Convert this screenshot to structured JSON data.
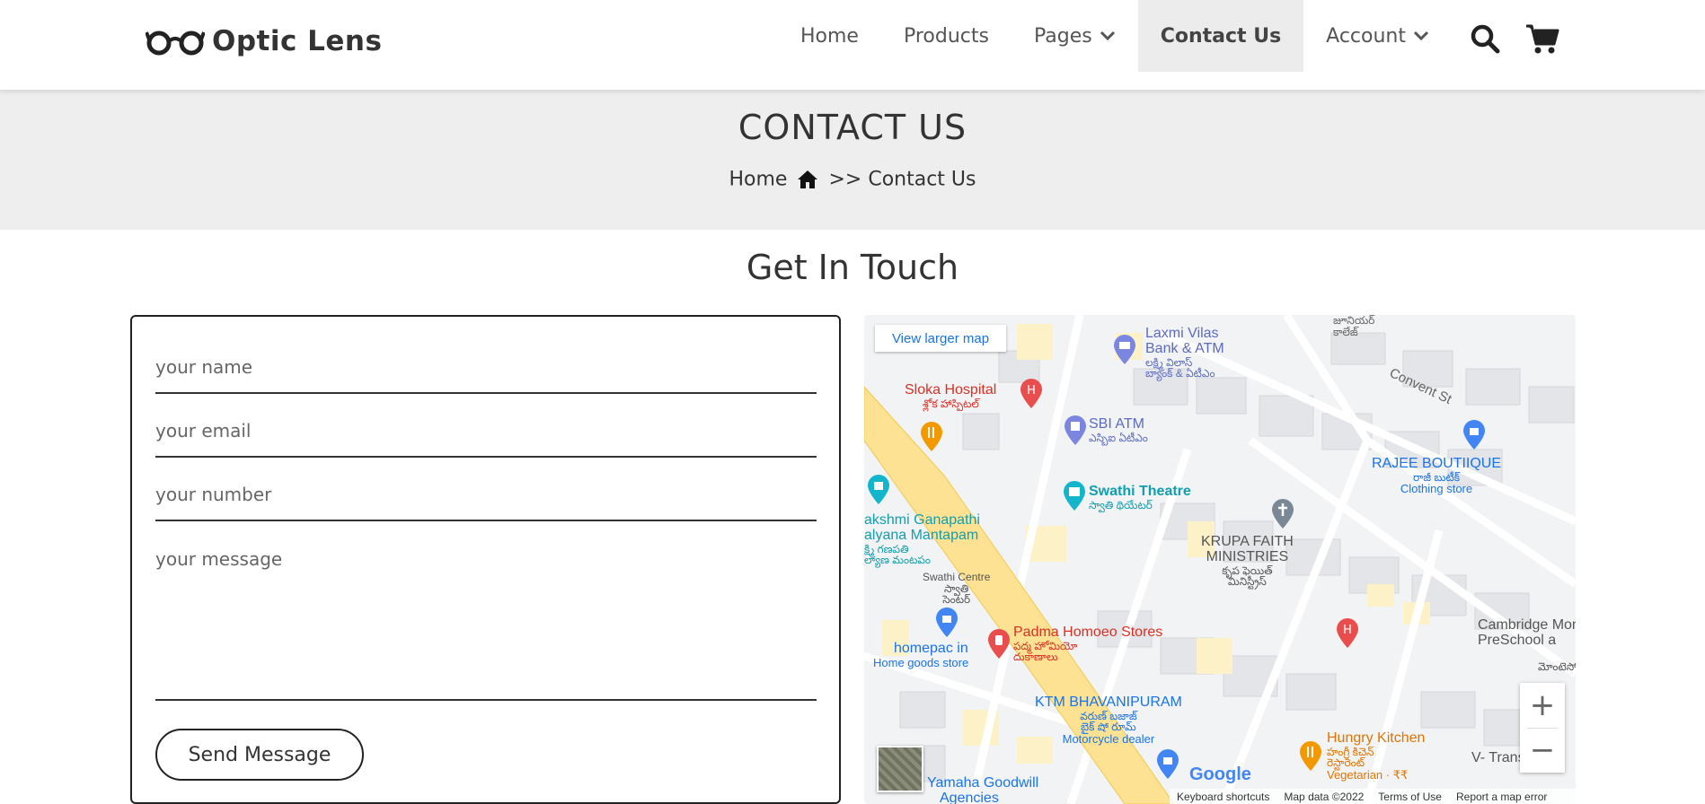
{
  "brand": {
    "name": "Optic Lens",
    "logo_icon": "glasses-icon"
  },
  "nav": {
    "items": [
      {
        "label": "Home",
        "dropdown": false,
        "active": false
      },
      {
        "label": "Products",
        "dropdown": false,
        "active": false
      },
      {
        "label": "Pages",
        "dropdown": true,
        "active": false
      },
      {
        "label": "Contact Us",
        "dropdown": false,
        "active": true
      },
      {
        "label": "Account",
        "dropdown": true,
        "active": false
      }
    ],
    "search_icon": "search-icon",
    "cart_icon": "cart-icon"
  },
  "banner": {
    "title": "CONTACT US",
    "crumb_home": "Home",
    "crumb_sep": ">>",
    "crumb_current": "Contact Us"
  },
  "section_title": "Get In Touch",
  "form": {
    "name_placeholder": "your name",
    "email_placeholder": "your email",
    "number_placeholder": "your number",
    "message_placeholder": "your message",
    "submit_label": "Send Message"
  },
  "map": {
    "view_larger": "View larger map",
    "zoom_in": "+",
    "zoom_out": "−",
    "google_logo": "Google",
    "attribution": {
      "shortcuts": "Keyboard shortcuts",
      "map_data": "Map data ©2022",
      "terms": "Terms of Use",
      "report": "Report a map error"
    },
    "labels": {
      "laxmi_vilas": "Laxmi Vilas",
      "bank_atm": "Bank & ATM",
      "laxmi_telugu": "లక్ష్మి విలాస్",
      "laxmi_telugu2": "బ్యాంక్ & ఏటీఎం",
      "sloka": "Sloka Hospital",
      "sloka_telugu": "శ్లోక హాస్పిటల్",
      "sbi": "SBI ATM",
      "sbi_telugu": "ఎస్బిఐ ఏటీఎం",
      "convent": "Convent St",
      "rajee": "RAJEE BOUTIIQUE",
      "rajee_telugu": "రాజీ బుటీక్",
      "clothing": "Clothing store",
      "swathi": "Swathi Theatre",
      "swathi_telugu": "స్వాతి థియేటర్",
      "lakshmi": "akshmi Ganapathi",
      "kalyana": "alyana Mantapam",
      "kalyana_telugu": "క్ష్మి గణపతి",
      "kalyana_telugu2": "ల్యాణ మంటపం",
      "krupa": "KRUPA FAITH",
      "ministries": "MINISTRIES",
      "krupa_telugu": "కృప ఫెయిత్",
      "krupa_telugu2": "మినిస్ట్రీస్",
      "swathi_centre": "Swathi Centre",
      "swathi_centre_telugu": "స్వాతి",
      "swathi_centre_telugu2": "సెంటర్",
      "cambridge": "Cambridge Montes",
      "preschool": "PreSchool a",
      "homepac": "homepac in",
      "home_goods": "Home goods store",
      "padma": "Padma Homoeo Stores",
      "padma_telugu": "పద్మ హోమియో",
      "padma_telugu2": "దుకాణాలు",
      "ktm": "KTM BHAVANIPURAM",
      "ktm_telugu": "వరుణ్ బజాజ్",
      "ktm_telugu2": "బైక్ షో రూమ్",
      "motorcycle": "Motorcycle dealer",
      "hungry": "Hungry Kitchen",
      "hungry_telugu": "హంగ్రీ కిచెన్",
      "hungry_telugu2": "రెస్టారెంట్",
      "vegetarian": "Vegetarian · ₹₹",
      "vtrans": "V- Trans In",
      "yamaha": "Yamaha Goodwill",
      "agencies": "Agencies",
      "junior_telugu": "జూనియర్",
      "college_telugu": "కాలేజ్",
      "montessori_telugu": "మోంటెసో"
    }
  }
}
